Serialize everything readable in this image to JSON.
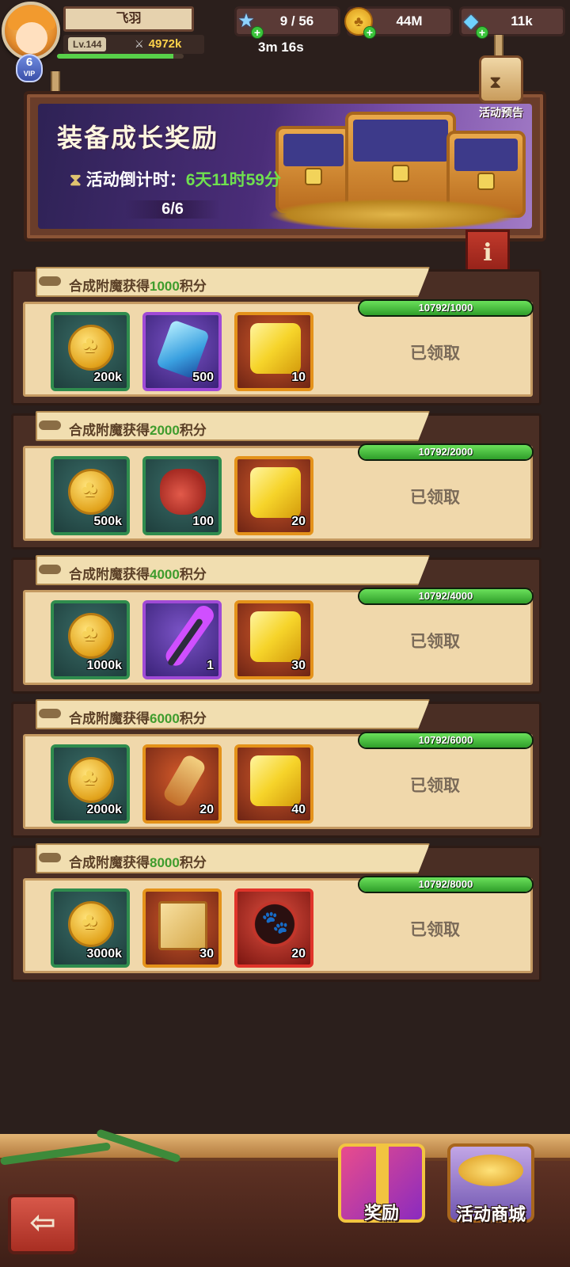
{
  "player": {
    "name": "飞羽",
    "level": "Lv.144",
    "power": "4972k",
    "vip_level": "6",
    "vip_label": "VIP",
    "xp_fraction": 0.92
  },
  "resources": {
    "stars": "9 / 56",
    "gold": "44M",
    "gems": "11k",
    "timer": "3m 16s"
  },
  "banner": {
    "title": "装备成长奖励",
    "countdown_label": "活动倒计时：",
    "countdown_value": "6天11时59分",
    "progress": "6/6",
    "preview_label": "活动预告"
  },
  "rewards": [
    {
      "title_prefix": "合成附魔获得",
      "points": "1000",
      "title_suffix": "积分",
      "progress_text": "10792/1000",
      "progress_fraction": 1.0,
      "status": "已领取",
      "items": [
        {
          "icon": "gold-coin",
          "qty": "200k",
          "rarity": "green"
        },
        {
          "icon": "blue-crystal",
          "qty": "500",
          "rarity": "purple"
        },
        {
          "icon": "gold-cube",
          "qty": "10",
          "rarity": "orange"
        }
      ]
    },
    {
      "title_prefix": "合成附魔获得",
      "points": "2000",
      "title_suffix": "积分",
      "progress_text": "10792/2000",
      "progress_fraction": 1.0,
      "status": "已领取",
      "items": [
        {
          "icon": "gold-coin",
          "qty": "500k",
          "rarity": "green"
        },
        {
          "icon": "red-bag",
          "qty": "100",
          "rarity": "green"
        },
        {
          "icon": "gold-cube",
          "qty": "20",
          "rarity": "orange"
        }
      ]
    },
    {
      "title_prefix": "合成附魔获得",
      "points": "4000",
      "title_suffix": "积分",
      "progress_text": "10792/4000",
      "progress_fraction": 1.0,
      "status": "已领取",
      "items": [
        {
          "icon": "gold-coin",
          "qty": "1000k",
          "rarity": "green"
        },
        {
          "icon": "lightning-staff",
          "qty": "1",
          "rarity": "purple"
        },
        {
          "icon": "gold-cube",
          "qty": "30",
          "rarity": "orange"
        }
      ]
    },
    {
      "title_prefix": "合成附魔获得",
      "points": "6000",
      "title_suffix": "积分",
      "progress_text": "10792/6000",
      "progress_fraction": 1.0,
      "status": "已领取",
      "items": [
        {
          "icon": "gold-coin",
          "qty": "2000k",
          "rarity": "green"
        },
        {
          "icon": "scroll",
          "qty": "20",
          "rarity": "orange"
        },
        {
          "icon": "gold-cube",
          "qty": "40",
          "rarity": "orange"
        }
      ]
    },
    {
      "title_prefix": "合成附魔获得",
      "points": "8000",
      "title_suffix": "积分",
      "progress_text": "10792/8000",
      "progress_fraction": 1.0,
      "status": "已领取",
      "items": [
        {
          "icon": "gold-coin",
          "qty": "3000k",
          "rarity": "green"
        },
        {
          "icon": "spell-book",
          "qty": "30",
          "rarity": "orange"
        },
        {
          "icon": "paw-badge",
          "qty": "20",
          "rarity": "red"
        }
      ]
    }
  ],
  "bottom_nav": {
    "back_icon": "arrow-left-icon",
    "reward_label": "奖励",
    "shop_label": "活动商城"
  }
}
